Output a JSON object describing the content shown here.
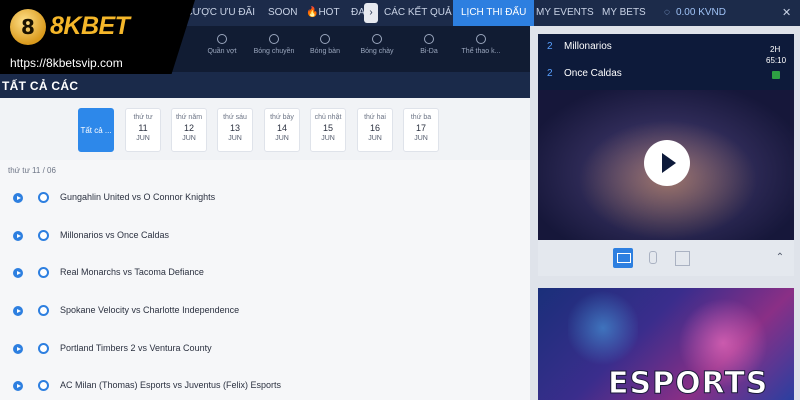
{
  "logo": {
    "badge": "8",
    "brand": "8KBET",
    "url": "https://8kbetsvip.com"
  },
  "nav": {
    "items": [
      "Ệ CƯỢC ƯU ĐÃI",
      "SOON",
      "🔥HOT",
      "ĐA",
      "CÁC KẾT QUẢ",
      "LỊCH THI ĐẤU",
      "MY EVENTS",
      "MY BETS"
    ],
    "arrow": "›",
    "balance": "0.00  KVND",
    "close": "✕"
  },
  "sports": [
    "Quần vợt",
    "Bóng chuyền",
    "Bóng bàn",
    "Bóng chày",
    "Bi-Da",
    "Thể thao k..."
  ],
  "page_title": "TẤT CẢ CÁC",
  "dates": {
    "all_label": "Tất cả ...",
    "tabs": [
      {
        "day": "thứ tư",
        "num": "11",
        "mon": "JUN"
      },
      {
        "day": "thứ năm",
        "num": "12",
        "mon": "JUN"
      },
      {
        "day": "thứ sáu",
        "num": "13",
        "mon": "JUN"
      },
      {
        "day": "thứ bảy",
        "num": "14",
        "mon": "JUN"
      },
      {
        "day": "chủ nhật",
        "num": "15",
        "mon": "JUN"
      },
      {
        "day": "thứ hai",
        "num": "16",
        "mon": "JUN"
      },
      {
        "day": "thứ ba",
        "num": "17",
        "mon": "JUN"
      }
    ]
  },
  "list": {
    "group_date": "thứ tư  11 / 06",
    "matches": [
      "Gungahlin United vs O Connor Knights",
      "Millonarios vs Once Caldas",
      "Real Monarchs vs Tacoma Defiance",
      "Spokane Velocity vs Charlotte Independence",
      "Portland Timbers 2 vs Ventura County",
      "AC Milan (Thomas) Esports vs Juventus (Felix) Esports"
    ]
  },
  "scoreboard": {
    "team1": {
      "score": "2",
      "name": "Millonarios"
    },
    "team2": {
      "score": "2",
      "name": "Once Caldas"
    },
    "period": "2H",
    "clock": "65:10"
  },
  "controls": {
    "up": "⌃"
  },
  "banner": {
    "text": "ESPORTS"
  }
}
